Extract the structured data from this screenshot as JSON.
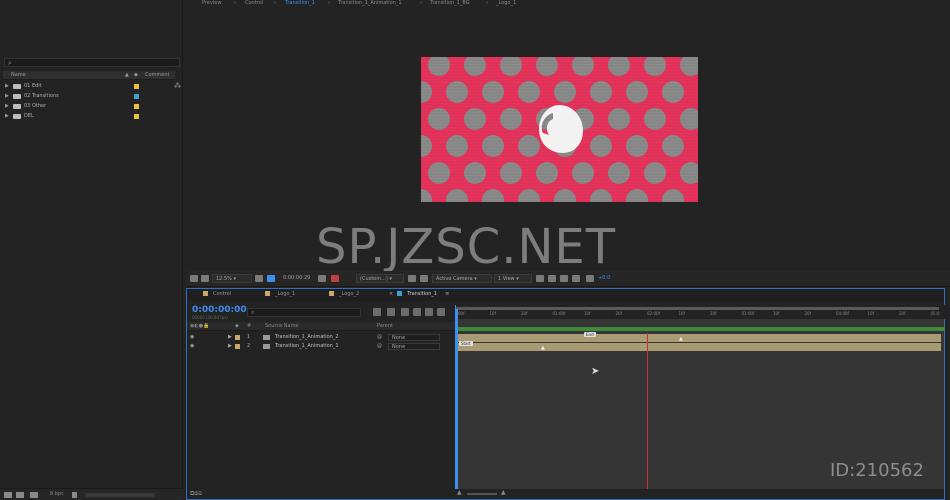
{
  "viewer_tabs": [
    "Preview",
    "Control",
    "Transition_1",
    "Transition_1_Animation_1",
    "Transition_1_BG",
    "_Logo_1"
  ],
  "project": {
    "columns": {
      "name": "Name",
      "comment": "Comment"
    },
    "items": [
      {
        "label": "01 Edit",
        "color": "#e8c43c"
      },
      {
        "label": "02 Transitions",
        "color": "#3aa0d8"
      },
      {
        "label": "03 Other",
        "color": "#e8c43c"
      },
      {
        "label": "DEL",
        "color": "#e8c43c"
      }
    ],
    "bpc": "8 bpc"
  },
  "viewer_toolbar": {
    "zoom": "12.5%",
    "timecode": "0:00:00:29",
    "resolution": "(Custom...)",
    "camera": "Active Camera",
    "views": "1 View",
    "exposure": "+0.0"
  },
  "watermark": "SP.JZSC.NET",
  "id_mark": "ID:210562",
  "timeline": {
    "tabs": [
      {
        "label": "Control",
        "color": "#c9a865"
      },
      {
        "label": "_Logo_1",
        "color": "#c9a865"
      },
      {
        "label": "_Logo_2",
        "color": "#c9a865"
      },
      {
        "label": "Transition_1",
        "color": "#3aa0d8"
      }
    ],
    "timecode": "0:00:00:00",
    "timecode_sub": "00000 (30.00 fps)",
    "columns": {
      "num": "#",
      "source": "Source Name",
      "parent": "Parent"
    },
    "layers": [
      {
        "num": "1",
        "name": "Transition_1_Animation_2",
        "parent": "None"
      },
      {
        "num": "2",
        "name": "Transition_1_Animation_1",
        "parent": "None"
      }
    ],
    "ruler": [
      "00f",
      "10f",
      "20f",
      "01:00f",
      "10f",
      "20f",
      "02:00f",
      "10f",
      "20f",
      "03:00f",
      "10f",
      "20f",
      "04:00f",
      "10f",
      "20f",
      "05:0"
    ],
    "markers": {
      "end": "End",
      "start": "Start"
    }
  },
  "colors": {
    "accent": "#3d8ff0",
    "comp_bg": "#e8345d",
    "dots": "#8c8c8c"
  }
}
